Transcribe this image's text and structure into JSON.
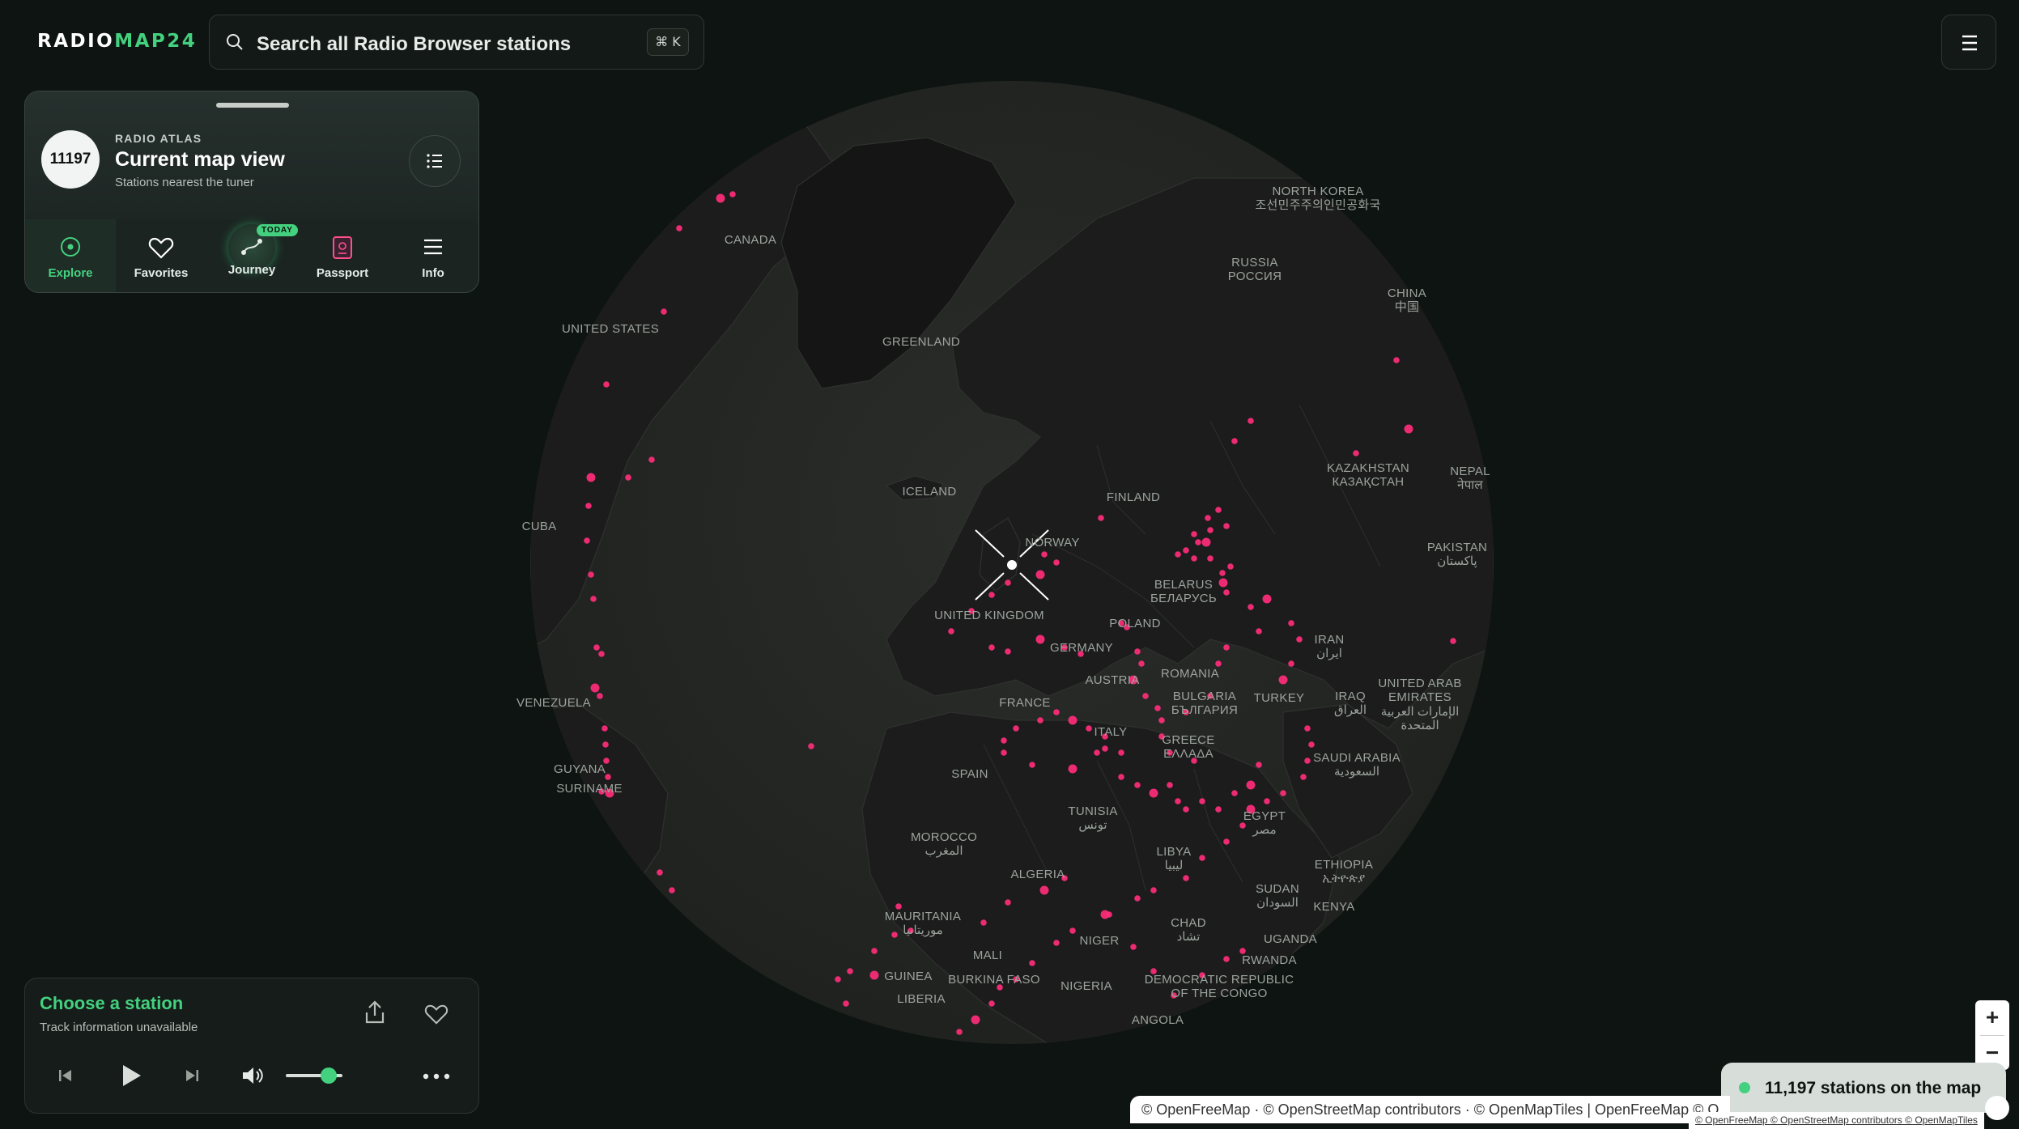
{
  "brand": {
    "logo_main": "RADIO",
    "logo_accent": "MAP24"
  },
  "search": {
    "placeholder": "Search all Radio Browser stations",
    "shortcut": "⌘ K"
  },
  "atlas": {
    "station_count": "11197",
    "eyebrow": "RADIO ATLAS",
    "title": "Current map view",
    "subtitle": "Stations nearest the tuner",
    "tabs": [
      {
        "label": "Explore",
        "icon": "explore-icon",
        "active": true
      },
      {
        "label": "Favorites",
        "icon": "heart-icon",
        "active": false
      },
      {
        "label": "Journey",
        "icon": "route-icon",
        "badge": "TODAY",
        "active": false
      },
      {
        "label": "Passport",
        "icon": "passport-icon",
        "active": false
      },
      {
        "label": "Info",
        "icon": "menu-icon",
        "active": false
      }
    ]
  },
  "player": {
    "title": "Choose a station",
    "subtitle": "Track information unavailable",
    "volume_fraction": 0.75
  },
  "map": {
    "labels": {
      "canada": "CANADA",
      "united_states": "UNITED STATES",
      "greenland": "GREENLAND",
      "iceland": "ICELAND",
      "north_korea": "NORTH KOREA",
      "north_korea_native": "조선민주주의인민공화국",
      "russia": "RUSSIA",
      "russia_native": "РОССИЯ",
      "china": "CHINA",
      "china_native": "中国",
      "finland": "FINLAND",
      "norway": "NORWAY",
      "kazakhstan": "KAZAKHSTAN",
      "kazakhstan_native": "КАЗАҚСТАН",
      "nepal": "NEPAL",
      "nepal_native": "नेपाल",
      "belarus": "BELARUS",
      "belarus_native": "БЕЛАРУСЬ",
      "cuba": "CUBA",
      "pakistan": "PAKISTAN",
      "pakistan_native": "پاکستان",
      "united_kingdom": "UNITED KINGDOM",
      "poland": "POLAND",
      "germany": "GERMANY",
      "iran": "IRAN",
      "iran_native": "ایران",
      "romania": "ROMANIA",
      "austria": "AUSTRIA",
      "uae": "UNITED ARAB",
      "uae2": "EMIRATES",
      "uae_native": "الإمارات العربية",
      "uae_native2": "المتحدة",
      "venezuela": "VENEZUELA",
      "france": "FRANCE",
      "bulgaria": "BULGARIA",
      "bulgaria_native": "БЪЛГАРИЯ",
      "turkey": "TURKEY",
      "iraq": "IRAQ",
      "iraq_native": "العراق",
      "italy": "ITALY",
      "greece": "GREECE",
      "greece_native": "ΕΛΛΑΔΑ",
      "saudi": "SAUDI ARABIA",
      "saudi_native": "السعودية",
      "guyana": "GUYANA",
      "suriname": "SURINAME",
      "spain": "SPAIN",
      "tunisia": "TUNISIA",
      "tunisia_native": "تونس",
      "egypt": "EGYPT",
      "egypt_native": "مصر",
      "morocco": "MOROCCO",
      "morocco_native": "المغرب",
      "libya": "LIBYA",
      "libya_native": "ليبيا",
      "algeria": "ALGERIA",
      "ethiopia": "ETHIOPIA",
      "ethiopia_native": "ኢትዮጵያ",
      "sudan": "SUDAN",
      "sudan_native": "السودان",
      "mauritania": "MAURITANIA",
      "mauritania_native": "موريتانيا",
      "kenya": "KENYA",
      "chad": "CHAD",
      "chad_native": "تشاد",
      "niger": "NIGER",
      "mali": "MALI",
      "uganda": "UGANDA",
      "rwanda": "RWANDA",
      "guinea": "GUINEA",
      "burkina": "BURKINA FASO",
      "nigeria": "NIGERIA",
      "drc": "DEMOCRATIC REPUBLIC",
      "drc2": "OF THE CONGO",
      "liberia": "LIBERIA",
      "angola": "ANGOLA"
    }
  },
  "status": {
    "stations_on_map": "11,197 stations on the map"
  },
  "attribution": {
    "main": "© OpenFreeMap · © OpenStreetMap contributors · © OpenMapTiles | OpenFreeMap © O",
    "small": "© OpenFreeMap © OpenStreetMap contributors © OpenMapTiles"
  },
  "colors": {
    "accent": "#44d17f",
    "station_dot": "#ff2d7a",
    "background": "#0e1411",
    "globe_ocean": "#262826",
    "land": "#1b1c1b"
  }
}
